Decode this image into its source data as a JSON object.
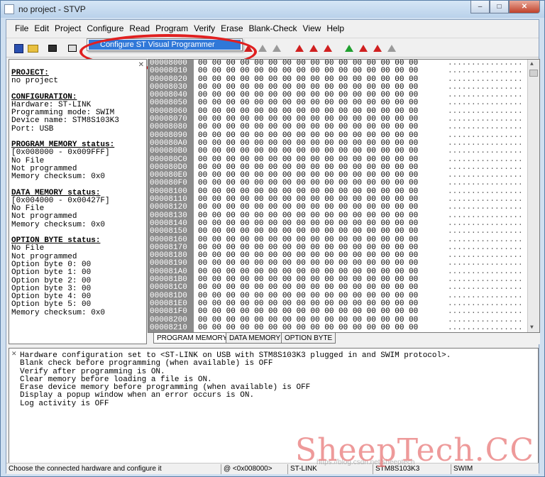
{
  "window": {
    "title": "no project - STVP"
  },
  "titlebar_buttons": [
    "–",
    "□",
    "✕"
  ],
  "menu": [
    "File",
    "Edit",
    "Project",
    "Configure",
    "Read",
    "Program",
    "Verify",
    "Erase",
    "Blank-Check",
    "View",
    "Help"
  ],
  "dropdown": {
    "item": "Configure ST Visual Programmer"
  },
  "left_panel": {
    "close_glyph": "✕",
    "sections": [
      {
        "title": "PROJECT:",
        "lines": [
          "no project"
        ]
      },
      {
        "title": "CONFIGURATION:",
        "lines": [
          "Hardware: ST-LINK",
          "Programming mode: SWIM",
          "Device name: STM8S103K3",
          "Port: USB"
        ]
      },
      {
        "title": "PROGRAM MEMORY status:",
        "lines": [
          "[0x008000 - 0x009FFF]",
          "No File",
          "Not programmed",
          "Memory checksum: 0x0"
        ]
      },
      {
        "title": "DATA MEMORY status:",
        "lines": [
          "[0x004000 - 0x00427F]",
          "No File",
          "Not programmed",
          "Memory checksum: 0x0"
        ]
      },
      {
        "title": "OPTION BYTE status:",
        "lines": [
          "No File",
          "Not programmed",
          "Option byte 0: 00",
          "Option byte 1: 00",
          "Option byte 2: 00",
          "Option byte 3: 00",
          "Option byte 4: 00",
          "Option byte 5: 00",
          "Memory checksum: 0x0"
        ]
      }
    ]
  },
  "hex": {
    "addresses": [
      "00008000",
      "00008010",
      "00008020",
      "00008030",
      "00008040",
      "00008050",
      "00008060",
      "00008070",
      "00008080",
      "00008090",
      "000080A0",
      "000080B0",
      "000080C0",
      "000080D0",
      "000080E0",
      "000080F0",
      "00008100",
      "00008110",
      "00008120",
      "00008130",
      "00008140",
      "00008150",
      "00008160",
      "00008170",
      "00008180",
      "00008190",
      "000081A0",
      "000081B0",
      "000081C0",
      "000081D0",
      "000081E0",
      "000081F0",
      "00008200",
      "00008210"
    ],
    "bytes_row": "00 00 00 00 00 00 00 00 00 00 00 00 00 00 00 00",
    "ascii_row": "................"
  },
  "tabs": [
    "PROGRAM MEMORY",
    "DATA MEMORY",
    "OPTION BYTE"
  ],
  "log_lines": [
    "Hardware configuration set to <ST-LINK on USB with STM8S103K3 plugged in and SWIM protocol>.",
    "Blank check before programming (when available) is OFF",
    "Verify after programming is ON.",
    "Clear memory before loading a file is ON.",
    "Erase device memory before programming (when available) is OFF",
    "Display a popup window when an error occurs is ON.",
    "Log activity is OFF"
  ],
  "statusbar": {
    "hint": "Choose the connected hardware and configure it",
    "address": "@ <0x008000>",
    "hardware": "ST-LINK",
    "device": "STM8S103K3",
    "protocol": "SWIM"
  },
  "watermark": {
    "big": "SheepTech.CC",
    "small": "https://blog.csdn.net/sheeptech"
  },
  "colors": {
    "annotation": "#e02020",
    "highlight": "#3078d8",
    "addr_bg": "#8c8c8c"
  }
}
